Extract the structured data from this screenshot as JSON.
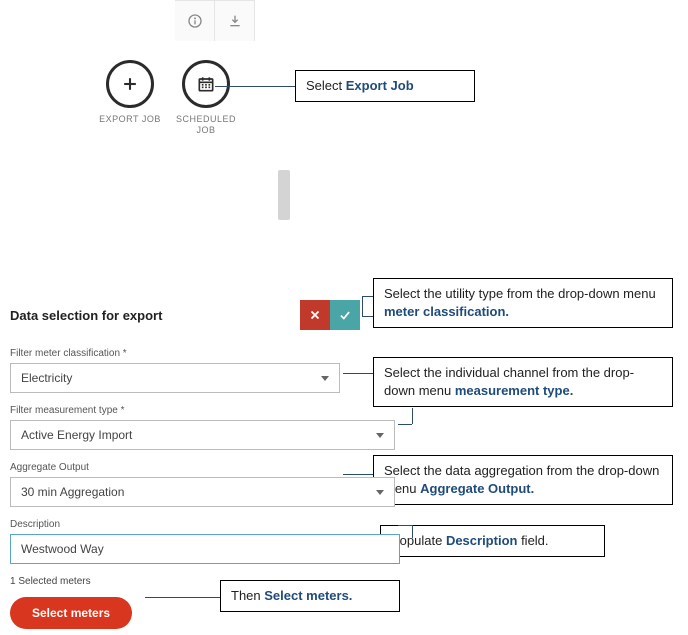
{
  "topIcons": {
    "info": "info-icon",
    "download": "download-icon"
  },
  "jobs": {
    "export": {
      "label": "EXPORT JOB"
    },
    "scheduled": {
      "label": "SCHEDULED JOB"
    }
  },
  "callouts": {
    "exportJob": {
      "prefix": "Select ",
      "bold": "Export Job"
    },
    "classification": {
      "text": "Select the utility type from the drop-down menu ",
      "bold": "meter classification."
    },
    "measurement": {
      "text": "Select the individual channel from the drop-down menu ",
      "bold": "measurement type."
    },
    "aggregate": {
      "text": "Select the data aggregation from the drop-down menu ",
      "bold": "Aggregate Output."
    },
    "description": {
      "prefix": "Populate ",
      "bold": "Description",
      "suffix": " field."
    },
    "selectMeters": {
      "prefix": "Then ",
      "bold": "Select meters."
    }
  },
  "form": {
    "title": "Data selection for export",
    "labels": {
      "classification": "Filter meter classification *",
      "measurement": "Filter measurement type *",
      "aggregate": "Aggregate Output",
      "description": "Description"
    },
    "values": {
      "classification": "Electricity",
      "measurement": "Active Energy Import",
      "aggregate": "30 min Aggregation",
      "description": "Westwood Way"
    },
    "selectedCount": "1 Selected meters",
    "selectMetersBtn": "Select meters"
  }
}
